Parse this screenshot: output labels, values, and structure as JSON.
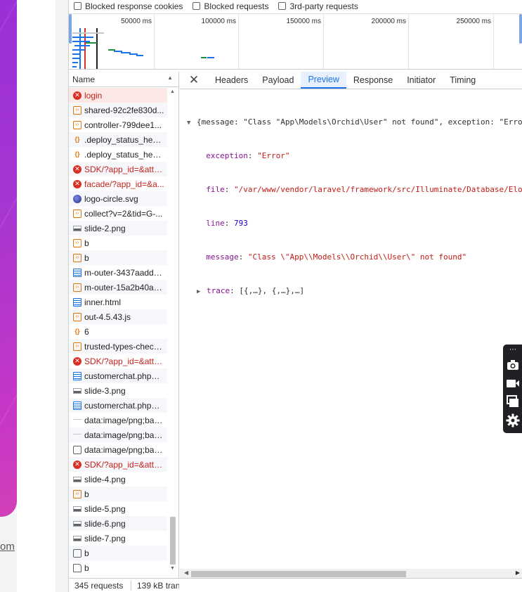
{
  "page": {
    "link_fragment": "om"
  },
  "filters": {
    "blocked_cookies": "Blocked response cookies",
    "blocked_requests": "Blocked requests",
    "third_party": "3rd-party requests"
  },
  "overview": {
    "ticks": [
      "50000 ms",
      "100000 ms",
      "150000 ms",
      "200000 ms",
      "250000 ms"
    ]
  },
  "name_header": "Name",
  "requests": [
    {
      "name": "login",
      "icon": "error-icon",
      "type": "err",
      "selected": true
    },
    {
      "name": "shared-92c2fe830d...",
      "icon": "xhr-icon",
      "type": "xhr"
    },
    {
      "name": "controller-799dee1...",
      "icon": "xhr-icon",
      "type": "xhr"
    },
    {
      "name": ".deploy_status_hens...",
      "icon": "script-icon",
      "type": "js"
    },
    {
      "name": ".deploy_status_hens...",
      "icon": "script-icon",
      "type": "js"
    },
    {
      "name": "SDK/?app_id=&attri...",
      "icon": "error-icon",
      "type": "err"
    },
    {
      "name": "facade/?app_id=&a...",
      "icon": "error-icon",
      "type": "err"
    },
    {
      "name": "logo-circle.svg",
      "icon": "logo-icon",
      "type": "logo"
    },
    {
      "name": "collect?v=2&tid=G-...",
      "icon": "xhr-icon",
      "type": "xhr"
    },
    {
      "name": "slide-2.png",
      "icon": "image-icon",
      "type": "img"
    },
    {
      "name": "b",
      "icon": "xhr-icon",
      "type": "xhr"
    },
    {
      "name": "b",
      "icon": "xhr-icon",
      "type": "xhr"
    },
    {
      "name": "m-outer-3437aaddc...",
      "icon": "document-icon",
      "type": "doc"
    },
    {
      "name": "m-outer-15a2b40a0...",
      "icon": "xhr-icon",
      "type": "xhr"
    },
    {
      "name": "inner.html",
      "icon": "document-icon",
      "type": "doc"
    },
    {
      "name": "out-4.5.43.js",
      "icon": "xhr-icon",
      "type": "xhr"
    },
    {
      "name": "6",
      "icon": "script-icon",
      "type": "js"
    },
    {
      "name": "trusted-types-check...",
      "icon": "xhr-icon",
      "type": "xhr"
    },
    {
      "name": "SDK/?app_id=&attri...",
      "icon": "error-icon",
      "type": "err"
    },
    {
      "name": "customerchat.php?a...",
      "icon": "document-icon",
      "type": "doc"
    },
    {
      "name": "slide-3.png",
      "icon": "image-icon",
      "type": "img"
    },
    {
      "name": "customerchat.php?a...",
      "icon": "document-icon",
      "type": "doc"
    },
    {
      "name": "data:image/png;bas...",
      "icon": "image-icon",
      "type": "imgfaint"
    },
    {
      "name": "data:image/png;bas...",
      "icon": "image-icon",
      "type": "imgfaint"
    },
    {
      "name": "data:image/png;bas...",
      "icon": "image-icon",
      "type": "box"
    },
    {
      "name": "SDK/?app_id=&attri...",
      "icon": "error-icon",
      "type": "err"
    },
    {
      "name": "slide-4.png",
      "icon": "image-icon",
      "type": "img"
    },
    {
      "name": "b",
      "icon": "xhr-icon",
      "type": "xhr"
    },
    {
      "name": "slide-5.png",
      "icon": "image-icon",
      "type": "img"
    },
    {
      "name": "slide-6.png",
      "icon": "image-icon",
      "type": "img"
    },
    {
      "name": "slide-7.png",
      "icon": "image-icon",
      "type": "img"
    },
    {
      "name": "b",
      "icon": "checkbox-icon",
      "type": "box"
    },
    {
      "name": "b",
      "icon": "file-icon",
      "type": "file"
    }
  ],
  "status": {
    "requests": "345 requests",
    "transferred": "139 kB tran"
  },
  "tabs": [
    "Headers",
    "Payload",
    "Preview",
    "Response",
    "Initiator",
    "Timing"
  ],
  "active_tab": "Preview",
  "preview": {
    "summary_open": "{message: \"Class \"App\\Models\\Orchid\\User\" not found\", exception: \"Error\"",
    "exception_key": "exception",
    "exception_val": "\"Error\"",
    "file_key": "file",
    "file_val": "\"/var/www/vendor/laravel/framework/src/Illuminate/Database/Eloquent",
    "line_key": "line",
    "line_val": "793",
    "message_key": "message",
    "message_val": "\"Class \\\"App\\\\Models\\\\Orchid\\\\User\\\" not found\"",
    "trace_key": "trace",
    "trace_val": "[{,…}, {,…},…]"
  },
  "colors": {
    "accent": "#1a73e8",
    "error": "#d93025",
    "selected_row": "#fce8e6"
  }
}
